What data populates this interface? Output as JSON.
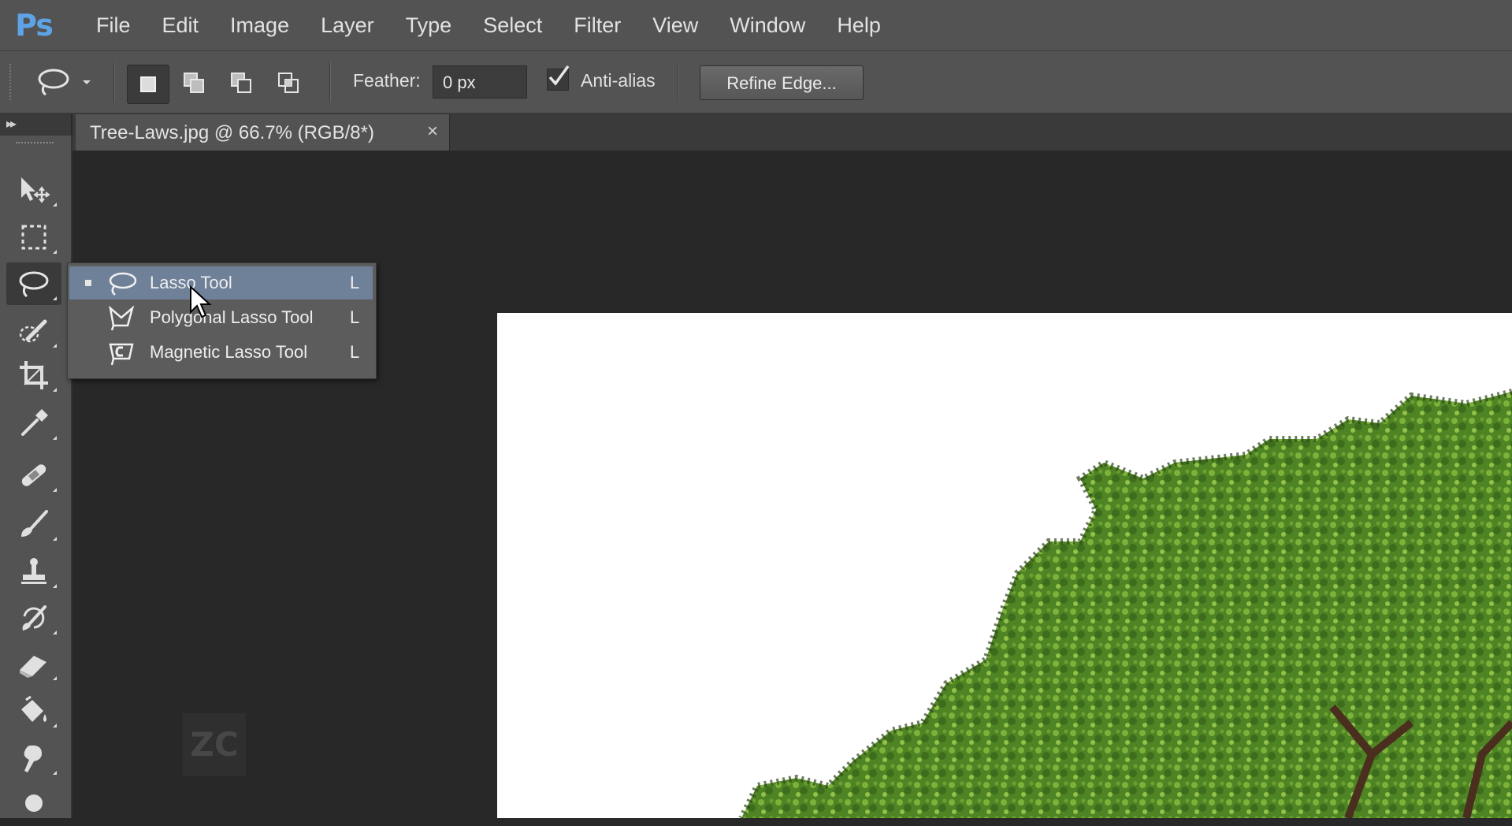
{
  "app": {
    "logo": "Ps"
  },
  "menu": [
    "File",
    "Edit",
    "Image",
    "Layer",
    "Type",
    "Select",
    "Filter",
    "View",
    "Window",
    "Help"
  ],
  "options_bar": {
    "feather_label": "Feather:",
    "feather_value": "0 px",
    "antialias_label": "Anti-alias",
    "antialias_checked": true,
    "refine_label": "Refine Edge..."
  },
  "document": {
    "tab_title": "Tree-Laws.jpg @ 66.7% (RGB/8*)",
    "close_glyph": "×"
  },
  "flyout": {
    "items": [
      {
        "label": "Lasso Tool",
        "key": "L",
        "icon": "lasso-icon",
        "selected": true
      },
      {
        "label": "Polygonal Lasso Tool",
        "key": "L",
        "icon": "polygonal-lasso-icon",
        "selected": false
      },
      {
        "label": "Magnetic Lasso Tool",
        "key": "L",
        "icon": "magnetic-lasso-icon",
        "selected": false
      }
    ]
  },
  "tools": [
    "move-tool-icon",
    "marquee-tool-icon",
    "lasso-tool-icon",
    "quick-selection-tool-icon",
    "crop-tool-icon",
    "eyedropper-tool-icon",
    "healing-brush-tool-icon",
    "brush-tool-icon",
    "clone-stamp-tool-icon",
    "history-brush-tool-icon",
    "eraser-tool-icon",
    "paint-bucket-tool-icon",
    "smudge-tool-icon",
    "dodge-tool-icon"
  ],
  "watermark": "ZC",
  "colors": {
    "panel": "#535353",
    "workspace": "#282828",
    "highlight": "#6f8099",
    "logo": "#5ea3e6",
    "foliage": "#5a8f2a"
  }
}
